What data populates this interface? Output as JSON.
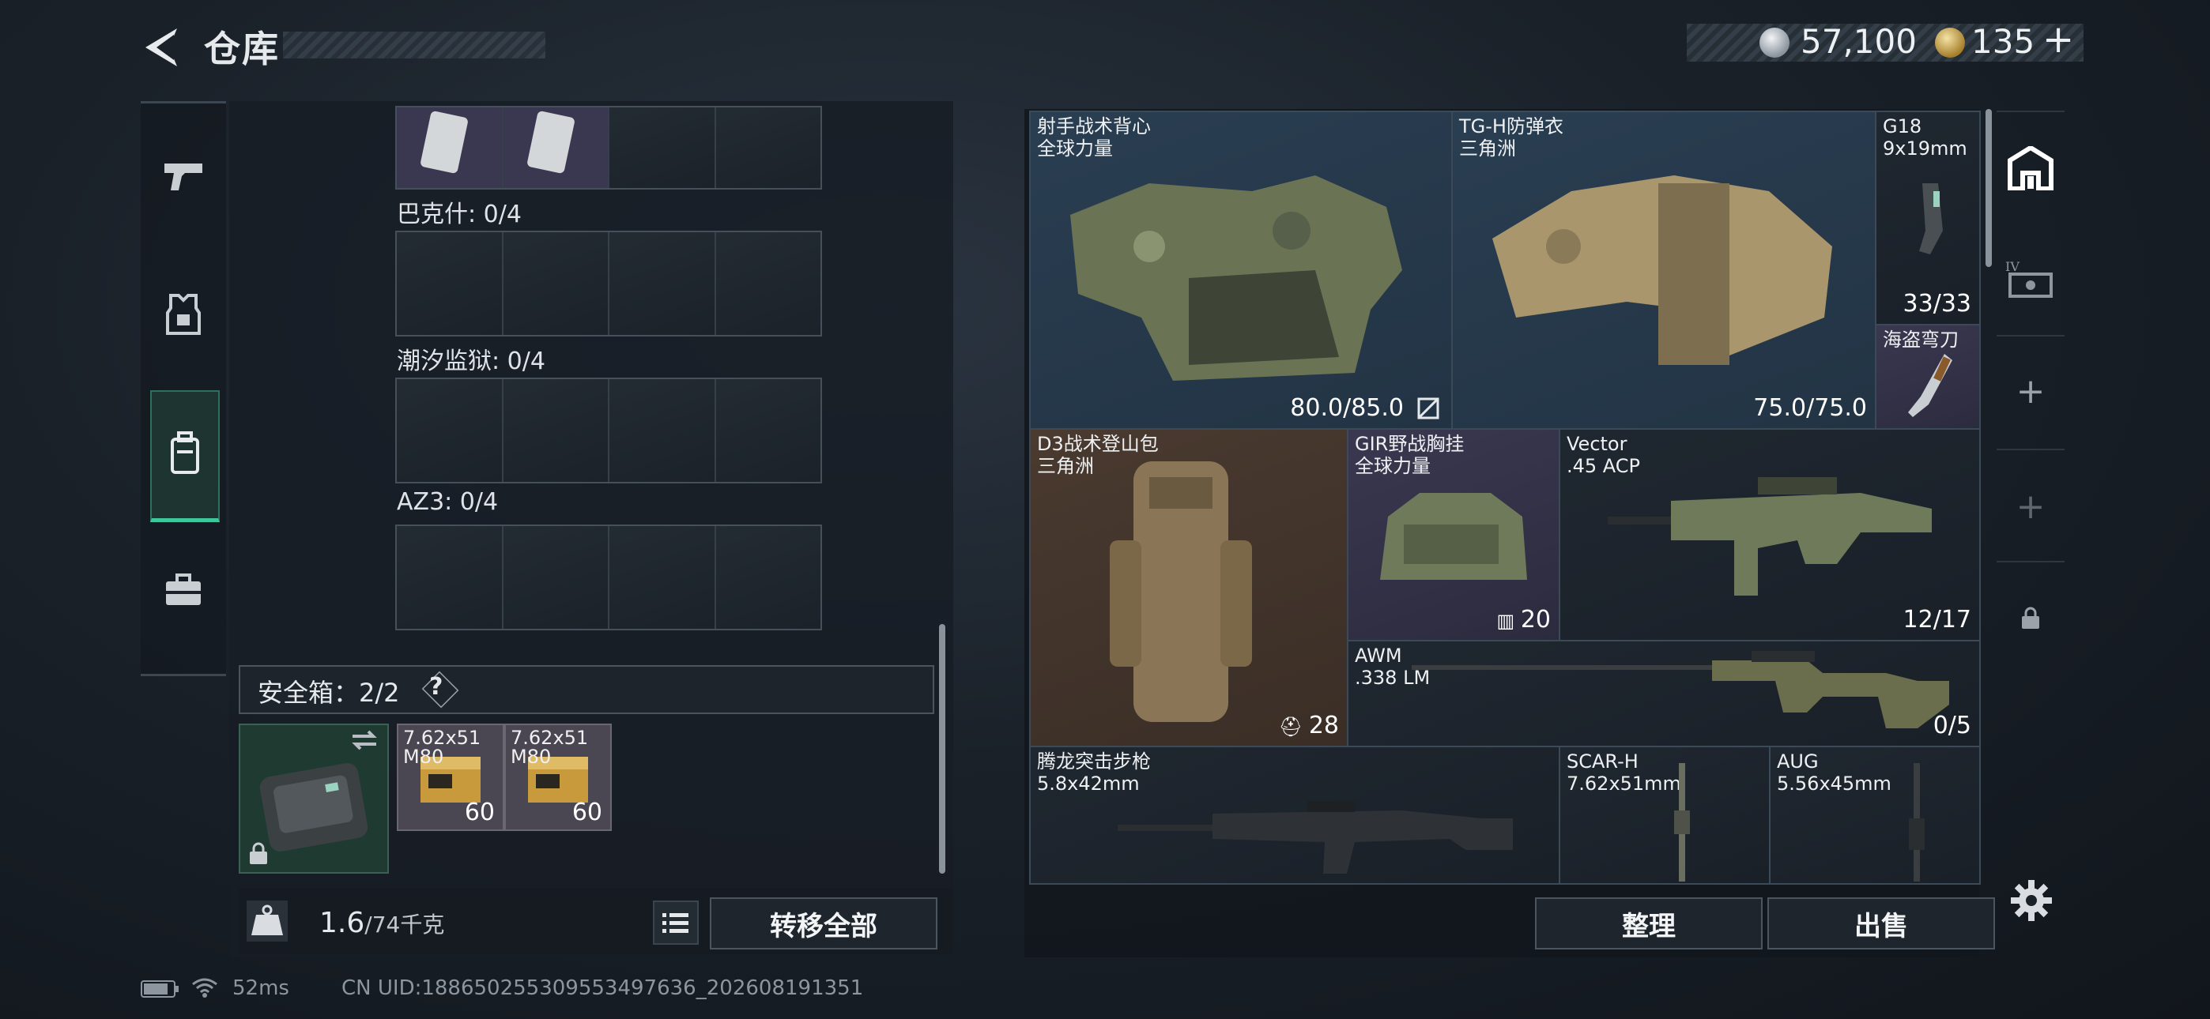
{
  "header": {
    "title": "仓库",
    "currency_silver": "57,100",
    "currency_gold": "135",
    "add_glyph": "+"
  },
  "sidebar": {
    "items": [
      {
        "icon": "pistol-icon",
        "active": false
      },
      {
        "icon": "armor-icon",
        "active": false
      },
      {
        "icon": "backpack-icon",
        "active": true
      },
      {
        "icon": "briefcase-icon",
        "active": false
      }
    ]
  },
  "left_panel": {
    "sections": [
      {
        "label": "巴克什: 0/4"
      },
      {
        "label": "潮汐监狱: 0/4"
      },
      {
        "label": "AZ3: 0/4"
      }
    ],
    "safe_box_label": "安全箱：2/2",
    "help_glyph": "?",
    "ammo": [
      {
        "name": "7.62x51 M80",
        "count": "60"
      },
      {
        "name": "7.62x51 M80",
        "count": "60"
      }
    ],
    "weight_value": "1.6",
    "weight_max": "/74千克",
    "transfer_all_label": "转移全部"
  },
  "right_panel": {
    "slots": [
      {
        "name": "射手战术背心",
        "sub": "全球力量",
        "value": "80.0/85.0"
      },
      {
        "name": "TG-H防弹衣",
        "sub": "三角洲",
        "value": "75.0/75.0"
      },
      {
        "name": "G18",
        "sub": "9x19mm",
        "value": "33/33"
      },
      {
        "name": "海盗弯刀",
        "sub": "",
        "value": ""
      },
      {
        "name": "D3战术登山包",
        "sub": "三角洲",
        "value": "28"
      },
      {
        "name": "GIR野战胸挂",
        "sub": "全球力量",
        "value": "20"
      },
      {
        "name": "Vector",
        "sub": ".45 ACP",
        "value": "12/17"
      },
      {
        "name": "AWM",
        "sub": ".338 LM",
        "value": "0/5"
      },
      {
        "name": "腾龙突击步枪",
        "sub": "5.8x42mm",
        "value": ""
      },
      {
        "name": "SCAR-H",
        "sub": "7.62x51mm",
        "value": ""
      },
      {
        "name": "AUG",
        "sub": "5.56x45mm",
        "value": ""
      }
    ],
    "organize_label": "整理",
    "sell_label": "出售"
  },
  "footer": {
    "ping": "52ms",
    "uid": "CN UID:18865025530955349763​6_202608191351"
  }
}
